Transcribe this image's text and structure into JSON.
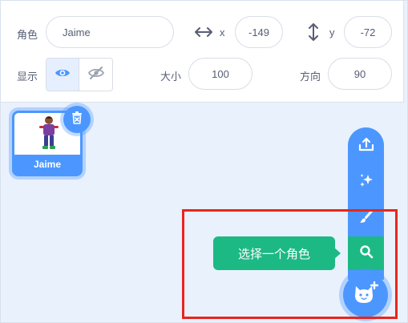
{
  "sprite_info": {
    "sprite_label": "角色",
    "sprite_name": "Jaime",
    "x_label": "x",
    "x_value": "-149",
    "y_label": "y",
    "y_value": "-72",
    "show_label": "显示",
    "size_label": "大小",
    "size_value": "100",
    "direction_label": "方向",
    "direction_value": "90"
  },
  "sprites": [
    {
      "name": "Jaime"
    }
  ],
  "sprite_menu": {
    "items": [
      {
        "icon": "upload-icon"
      },
      {
        "icon": "surprise-icon"
      },
      {
        "icon": "paint-icon"
      },
      {
        "icon": "search-icon"
      }
    ],
    "tooltip": "选择一个角色",
    "main_icon": "cat-add-icon"
  },
  "colors": {
    "accent": "#4c97ff",
    "search_green": "#1cb985",
    "highlight_red": "#e8251f",
    "text": "#575e75",
    "pane_bg": "#e9f1fc"
  }
}
